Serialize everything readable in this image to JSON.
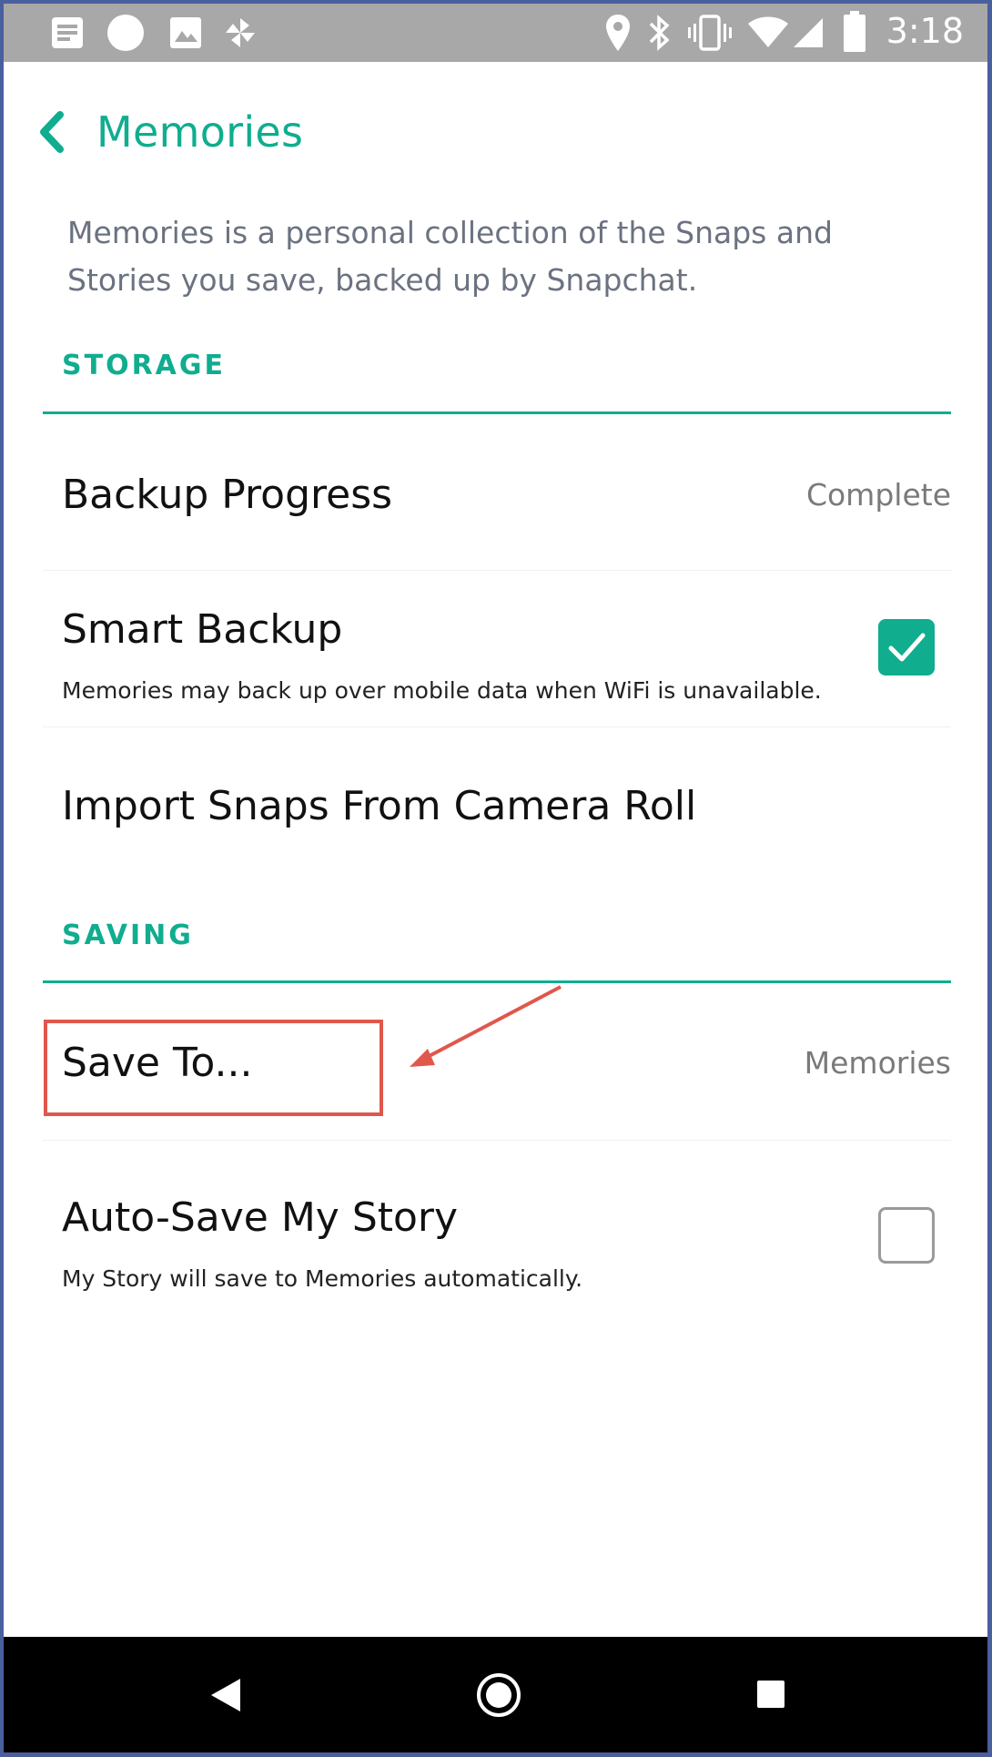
{
  "status_bar": {
    "time": "3:18",
    "left_icons": [
      "notes-icon",
      "circle-icon",
      "image-icon",
      "pinwheel-icon"
    ],
    "right_icons": [
      "location-icon",
      "bluetooth-icon",
      "vibrate-icon",
      "wifi-icon",
      "signal-icon",
      "battery-icon"
    ]
  },
  "header": {
    "title": "Memories",
    "back_icon": "chevron-left-icon"
  },
  "intro": "Memories is a personal collection of the Snaps and Stories you save, backed up by Snapchat.",
  "storage": {
    "header": "STORAGE",
    "backup_progress": {
      "label": "Backup Progress",
      "value": "Complete"
    },
    "smart_backup": {
      "label": "Smart Backup",
      "description": "Memories may back up over mobile data when WiFi is unavailable.",
      "checked": true
    },
    "import": {
      "label": "Import Snaps From Camera Roll"
    }
  },
  "saving": {
    "header": "SAVING",
    "save_to": {
      "label": "Save To...",
      "value": "Memories"
    },
    "auto_save": {
      "label": "Auto-Save My Story",
      "description": "My Story will save to Memories automatically.",
      "checked": false
    }
  },
  "colors": {
    "accent": "#10ad8f",
    "annotation": "#e0574c",
    "status_bar": "#a8a8a8"
  },
  "nav": [
    "back-triangle-icon",
    "home-circle-icon",
    "recents-square-icon"
  ]
}
